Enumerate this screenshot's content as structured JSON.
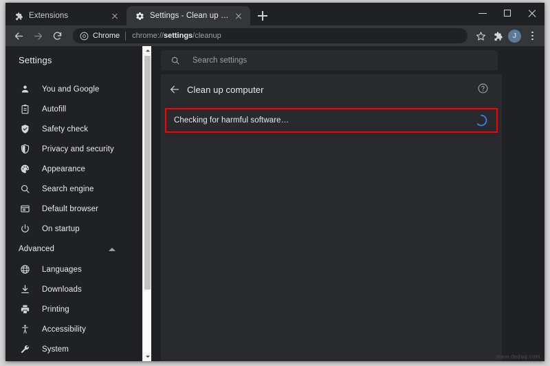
{
  "window": {
    "controls": {
      "minimize": "minimize",
      "maximize": "maximize",
      "close": "close"
    }
  },
  "tabs": [
    {
      "title": "Extensions",
      "icon": "puzzle-piece-icon",
      "active": false
    },
    {
      "title": "Settings - Clean up computer",
      "icon": "gear-icon",
      "active": true
    }
  ],
  "new_tab_label": "+",
  "toolbar": {
    "back": "back",
    "forward": "forward",
    "reload": "reload",
    "omnibox": {
      "chip_label": "Chrome",
      "url_prefix": "chrome://",
      "url_bold": "settings",
      "url_suffix": "/cleanup"
    },
    "bookmark": "star-icon",
    "extensions": "puzzle-piece-icon",
    "profile_initial": "J",
    "menu": "three-dot-menu-icon"
  },
  "sidebar": {
    "title": "Settings",
    "items": [
      {
        "label": "You and Google",
        "icon": "person-icon"
      },
      {
        "label": "Autofill",
        "icon": "clipboard-icon"
      },
      {
        "label": "Safety check",
        "icon": "shield-check-icon"
      },
      {
        "label": "Privacy and security",
        "icon": "shield-icon"
      },
      {
        "label": "Appearance",
        "icon": "palette-icon"
      },
      {
        "label": "Search engine",
        "icon": "magnifier-icon"
      },
      {
        "label": "Default browser",
        "icon": "browser-window-icon"
      },
      {
        "label": "On startup",
        "icon": "power-icon"
      }
    ],
    "advanced": {
      "label": "Advanced",
      "expanded": true,
      "items": [
        {
          "label": "Languages",
          "icon": "globe-icon"
        },
        {
          "label": "Downloads",
          "icon": "download-icon"
        },
        {
          "label": "Printing",
          "icon": "printer-icon"
        },
        {
          "label": "Accessibility",
          "icon": "accessibility-icon"
        },
        {
          "label": "System",
          "icon": "wrench-icon"
        }
      ]
    }
  },
  "search": {
    "placeholder": "Search settings",
    "value": "",
    "icon": "search-icon"
  },
  "main": {
    "back_icon": "arrow-left-icon",
    "title": "Clean up computer",
    "help_icon": "help-circle-icon",
    "status_row": {
      "label": "Checking for harmful software…",
      "spinner": "loading-spinner-icon",
      "highlight_color": "#ff0000",
      "spinner_color": "#3b7ddd"
    }
  },
  "watermark": "www.dedaq.com"
}
